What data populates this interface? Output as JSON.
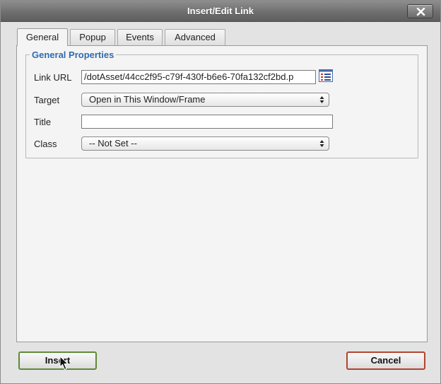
{
  "dialog": {
    "title": "Insert/Edit Link",
    "close_icon": "close-x-icon"
  },
  "tabs": [
    {
      "label": "General",
      "active": true
    },
    {
      "label": "Popup",
      "active": false
    },
    {
      "label": "Events",
      "active": false
    },
    {
      "label": "Advanced",
      "active": false
    }
  ],
  "general": {
    "legend": "General Properties",
    "link_url": {
      "label": "Link URL",
      "value": "/dotAsset/44cc2f95-c79f-430f-b6e6-70fa132cf2bd.p",
      "browse_icon": "browse-list-icon"
    },
    "target": {
      "label": "Target",
      "selected": "Open in This Window/Frame"
    },
    "title": {
      "label": "Title",
      "value": ""
    },
    "class": {
      "label": "Class",
      "selected": "-- Not Set --"
    }
  },
  "footer": {
    "insert_label": "Insert",
    "cancel_label": "Cancel"
  },
  "colors": {
    "legend": "#2e6ab0",
    "insert_border": "#5f8a37",
    "cancel_border": "#b3432e"
  }
}
